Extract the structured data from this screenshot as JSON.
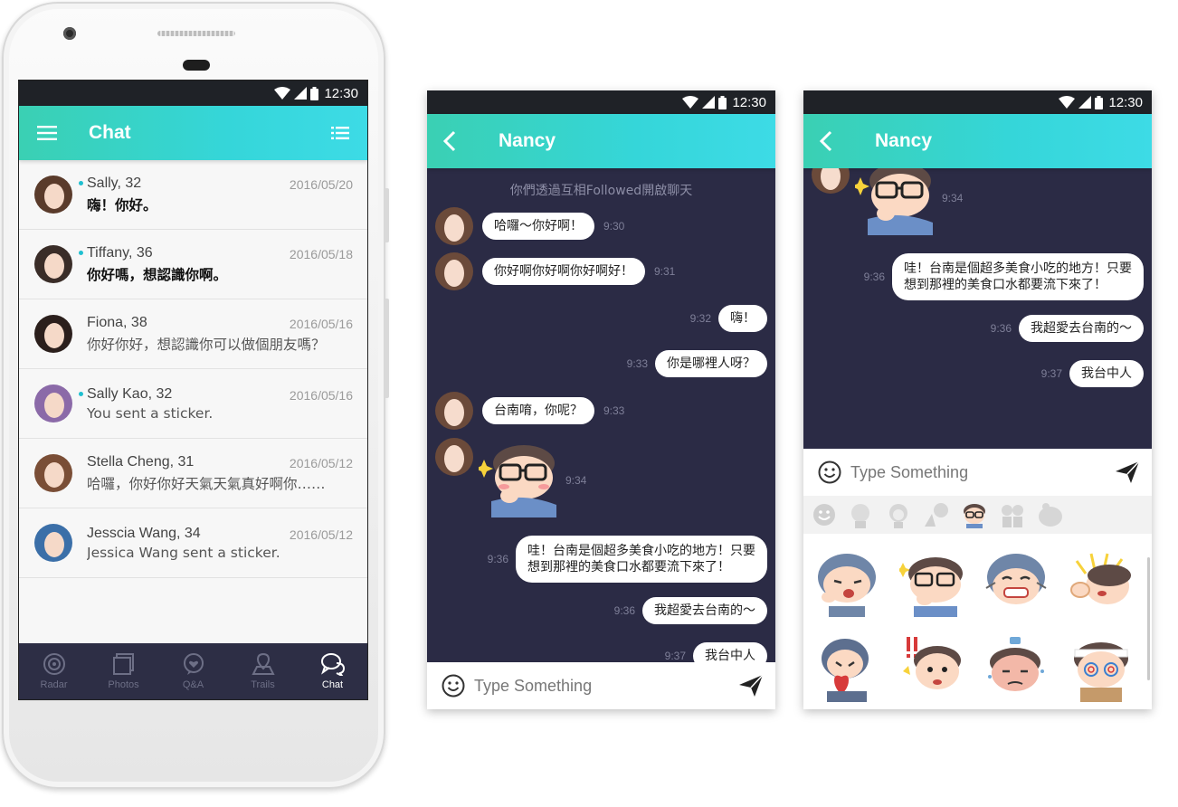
{
  "status": {
    "time": "12:30"
  },
  "chat_list": {
    "title": "Chat",
    "items": [
      {
        "name": "Sally, 32",
        "date": "2016/05/20",
        "message": "嗨！你好。",
        "online": true,
        "unread": true
      },
      {
        "name": "Tiffany, 36",
        "date": "2016/05/18",
        "message": "你好嗎，想認識你啊。",
        "online": true,
        "unread": true
      },
      {
        "name": "Fiona, 38",
        "date": "2016/05/16",
        "message": "你好你好，想認識你可以做個朋友嗎？",
        "online": false,
        "unread": false
      },
      {
        "name": "Sally Kao, 32",
        "date": "2016/05/16",
        "message": "You sent a sticker.",
        "online": true,
        "unread": false
      },
      {
        "name": "Stella Cheng, 31",
        "date": "2016/05/12",
        "message": "哈囉，你好你好天氣天氣真好啊你……",
        "online": false,
        "unread": false
      },
      {
        "name": "Jesscia Wang, 34",
        "date": "2016/05/12",
        "message": "Jessica Wang sent a sticker.",
        "online": false,
        "unread": false
      }
    ],
    "tabs": [
      "Radar",
      "Photos",
      "Q&A",
      "Trails",
      "Chat"
    ]
  },
  "conversation": {
    "contact": "Nancy",
    "system_note": "你們透過互相Followed開啟聊天",
    "messages": [
      {
        "from": "them",
        "text": "哈囉～你好啊！",
        "time": "9:30"
      },
      {
        "from": "them",
        "text": "你好啊你好啊你好啊好！",
        "time": "9:31"
      },
      {
        "from": "me",
        "text": "嗨！",
        "time": "9:32"
      },
      {
        "from": "me",
        "text": "你是哪裡人呀？",
        "time": "9:33"
      },
      {
        "from": "them",
        "text": "台南唷，你呢？",
        "time": "9:33"
      },
      {
        "from": "them",
        "sticker": "glasses-boy-sticker",
        "time": "9:34"
      },
      {
        "from": "me",
        "text_line1": "哇！台南是個超多美食小吃的地方！只要",
        "text_line2": "想到那裡的美食口水都要流下來了！",
        "time": "9:36"
      },
      {
        "from": "me",
        "text": "我超愛去台南的～",
        "time": "9:36"
      },
      {
        "from": "me",
        "text": "我台中人",
        "time": "9:37"
      }
    ],
    "input_placeholder": "Type Something"
  },
  "colors": {
    "header_start": "#3ad0b3",
    "header_end": "#3ddbe6",
    "chat_bg": "#2b2b45",
    "tabbar_bg": "#2d2e45",
    "online_dot": "#1fbfd0"
  }
}
